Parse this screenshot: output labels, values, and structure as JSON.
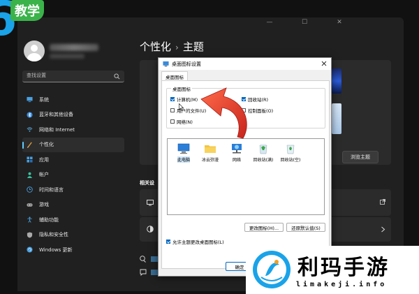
{
  "brand": {
    "badge_text": "教学",
    "badge_digit": "6"
  },
  "sidebar": {
    "search_placeholder": "查找设置",
    "items": [
      {
        "label": "系统",
        "icon": "monitor-icon",
        "color": "#4aa0e0"
      },
      {
        "label": "蓝牙和其他设备",
        "icon": "bluetooth-icon",
        "color": "#3b8ee0"
      },
      {
        "label": "网络和 Internet",
        "icon": "wifi-icon",
        "color": "#60b8f0"
      },
      {
        "label": "个性化",
        "icon": "pen-icon",
        "color": "#e0a040",
        "active": true
      },
      {
        "label": "应用",
        "icon": "apps-icon",
        "color": "#4aa0e0"
      },
      {
        "label": "帐户",
        "icon": "account-icon",
        "color": "#3bc4a0"
      },
      {
        "label": "时间和语言",
        "icon": "globe-clock-icon",
        "color": "#4aa0e0"
      },
      {
        "label": "游戏",
        "icon": "gamepad-icon",
        "color": "#aaaaaa"
      },
      {
        "label": "辅助功能",
        "icon": "accessibility-icon",
        "color": "#4aa0e0"
      },
      {
        "label": "隐私和安全性",
        "icon": "shield-icon",
        "color": "#aaaaaa"
      },
      {
        "label": "Windows 更新",
        "icon": "update-icon",
        "color": "#4aa0e0"
      }
    ]
  },
  "main": {
    "breadcrumb_parent": "个性化",
    "breadcrumb_sep": "›",
    "breadcrumb_current": "主题",
    "browse_button": "浏览主题",
    "related_label": "相关设"
  },
  "dialog": {
    "title": "桌面图标设置",
    "tab": "桌面图标",
    "group_legend": "桌面图标",
    "checkboxes": [
      {
        "label": "计算机(M)",
        "checked": true
      },
      {
        "label": "回收站(R)",
        "checked": true
      },
      {
        "label": "用户的文件(U)",
        "checked": false
      },
      {
        "label": "控制面板(O)",
        "checked": false
      },
      {
        "label": "网络(N)",
        "checked": false
      }
    ],
    "icons": [
      {
        "label": "此电脑",
        "icon": "this-pc-icon"
      },
      {
        "label": "冰云弥漫",
        "icon": "user-folder-icon"
      },
      {
        "label": "网络",
        "icon": "network-icon"
      },
      {
        "label": "回收站(满)",
        "icon": "recycle-bin-full-icon"
      },
      {
        "label": "回收站(空)",
        "icon": "recycle-bin-empty-icon"
      }
    ],
    "change_icon_button": "更改图标(H)...",
    "restore_default_button": "还原默认值(S)",
    "allow_theme_label": "允许主题更改桌面图标(L)",
    "allow_theme_checked": true,
    "ok_button": "确定"
  },
  "watermark": {
    "title": "利玛手游",
    "subtitle": "limakeji.info"
  },
  "colors": {
    "accent": "#60cdff",
    "arrow": "#e0352b",
    "checkbox": "#0067c0"
  }
}
